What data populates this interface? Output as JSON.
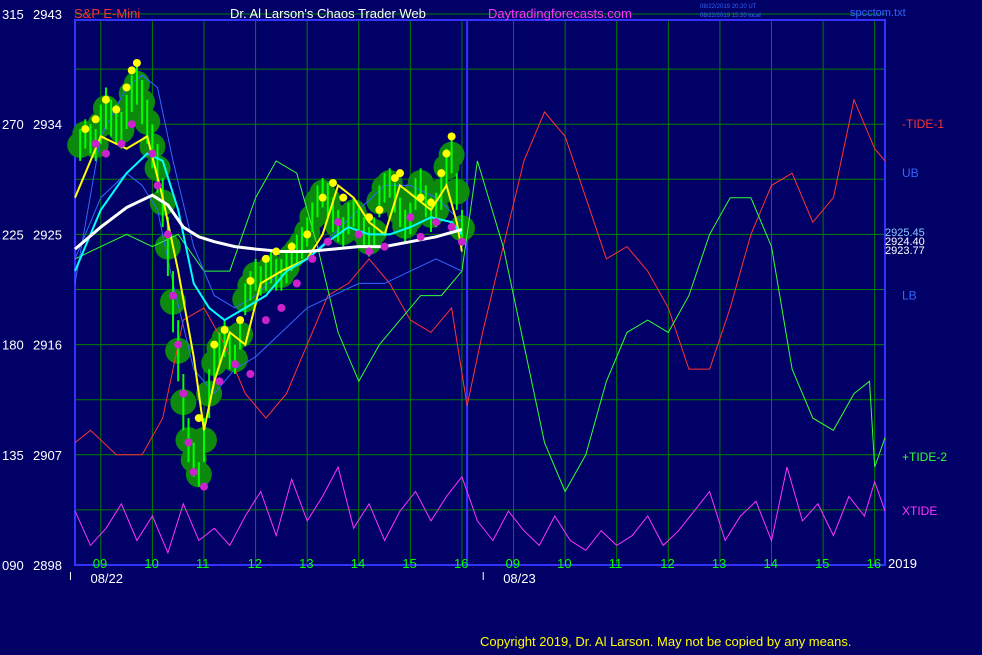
{
  "header": {
    "instrument": "S&P E-Mini",
    "site_title": "Dr. Al Larson's Chaos Trader Web",
    "site_url": "Daytradingforecasts.com",
    "stamp_line1": "08/22/2019 20:20 UT",
    "stamp_line2": "08/22/2019 15:20 local",
    "file_name": "spcctom.txt"
  },
  "footer": {
    "copyright": "Copyright 2019, Dr. Al Larson. May not be copied by any means."
  },
  "colors": {
    "background": "#000066",
    "grid": "#008000",
    "frame": "#3333ff",
    "price_bars": "#00ff00",
    "fast_avg": "#ffff00",
    "mid_avg": "#00ffff",
    "slow_avg": "#ffffff",
    "band": "#3366ff",
    "tide1": "#ff3333",
    "tide2": "#33ff33",
    "xtide": "#ff33ff",
    "highlight_glow": "#0d8a0d",
    "highs_dots": "#ffff00",
    "lows_dots": "#cc22cc"
  },
  "chart_data": {
    "type": "line",
    "y_axis_left_labels": [
      "315",
      "270",
      "225",
      "180",
      "135",
      "090"
    ],
    "y_axis_price_labels": [
      "2943",
      "2934",
      "2925",
      "2916",
      "2907",
      "2898"
    ],
    "y_ticks": [
      315,
      270,
      225,
      180,
      135,
      90
    ],
    "ylim": [
      90,
      315
    ],
    "x_ticks": [
      "09",
      "10",
      "11",
      "12",
      "13",
      "14",
      "15",
      "16",
      "09",
      "10",
      "11",
      "12",
      "13",
      "14",
      "15",
      "16"
    ],
    "x_tick_positions": [
      9,
      10,
      11,
      12,
      13,
      14,
      15,
      16,
      17,
      18,
      19,
      20,
      21,
      22,
      23,
      24
    ],
    "xlim": [
      8.5,
      24.2
    ],
    "date_labels": [
      {
        "text": "08/22",
        "x": 8.8
      },
      {
        "text": "08/23",
        "x": 16.8
      }
    ],
    "day_separator_x": 16.1,
    "year_label": "2019",
    "current_price_labels": [
      {
        "text": "2925.45",
        "color": "#88ccff"
      },
      {
        "text": "2924.40",
        "color": "#ffffff"
      },
      {
        "text": "2923.77",
        "color": "#ffffff"
      }
    ],
    "series": [
      {
        "name": "-TIDE-1",
        "legend_y": 270,
        "x": [
          8.5,
          8.8,
          9.3,
          9.8,
          10.2,
          10.6,
          11.0,
          11.4,
          11.8,
          12.2,
          12.6,
          13.0,
          13.4,
          13.8,
          14.2,
          14.6,
          15.0,
          15.4,
          15.8,
          16.1,
          16.4,
          16.8,
          17.2,
          17.6,
          18.0,
          18.4,
          18.8,
          19.2,
          19.6,
          20.0,
          20.4,
          20.8,
          21.2,
          21.6,
          22.0,
          22.4,
          22.8,
          23.2,
          23.6,
          23.9,
          24.0,
          24.2
        ],
        "values": [
          140,
          145,
          135,
          135,
          150,
          190,
          195,
          180,
          160,
          150,
          160,
          180,
          200,
          205,
          215,
          205,
          190,
          185,
          195,
          155,
          185,
          220,
          255,
          275,
          265,
          240,
          215,
          220,
          210,
          195,
          170,
          170,
          195,
          225,
          245,
          250,
          230,
          240,
          280,
          265,
          260,
          255
        ]
      },
      {
        "name": "+TIDE-2",
        "legend_y": 134,
        "x": [
          8.5,
          9.0,
          9.5,
          10.0,
          10.5,
          11.0,
          11.5,
          12.0,
          12.4,
          12.8,
          13.2,
          13.6,
          14.0,
          14.4,
          14.8,
          15.2,
          15.6,
          16.0,
          16.3,
          16.8,
          17.2,
          17.6,
          18.0,
          18.4,
          18.8,
          19.2,
          19.6,
          20.0,
          20.4,
          20.8,
          21.2,
          21.6,
          22.0,
          22.4,
          22.8,
          23.2,
          23.6,
          23.9,
          24.0,
          24.2
        ],
        "values": [
          215,
          220,
          225,
          220,
          225,
          210,
          210,
          240,
          255,
          250,
          220,
          185,
          165,
          180,
          190,
          200,
          200,
          210,
          255,
          220,
          180,
          140,
          120,
          135,
          165,
          185,
          190,
          185,
          200,
          225,
          240,
          240,
          220,
          170,
          150,
          145,
          160,
          165,
          130,
          142
        ]
      },
      {
        "name": "XTIDE",
        "legend_y": 112,
        "x": [
          8.5,
          8.8,
          9.1,
          9.4,
          9.7,
          10.0,
          10.3,
          10.6,
          10.9,
          11.2,
          11.5,
          11.8,
          12.1,
          12.4,
          12.7,
          13.0,
          13.3,
          13.6,
          13.9,
          14.2,
          14.5,
          14.8,
          15.1,
          15.4,
          15.7,
          16.0,
          16.3,
          16.6,
          16.9,
          17.2,
          17.5,
          17.8,
          18.1,
          18.4,
          18.7,
          19.0,
          19.3,
          19.6,
          19.9,
          20.2,
          20.5,
          20.8,
          21.1,
          21.4,
          21.7,
          22.0,
          22.3,
          22.6,
          22.9,
          23.2,
          23.5,
          23.8,
          24.0,
          24.2
        ],
        "values": [
          112,
          98,
          105,
          115,
          100,
          110,
          95,
          115,
          100,
          105,
          98,
          110,
          120,
          102,
          125,
          108,
          118,
          130,
          105,
          115,
          100,
          112,
          120,
          108,
          118,
          126,
          108,
          100,
          112,
          104,
          98,
          110,
          100,
          96,
          104,
          98,
          102,
          110,
          98,
          104,
          112,
          120,
          100,
          110,
          116,
          100,
          130,
          108,
          115,
          102,
          118,
          110,
          124,
          112
        ]
      },
      {
        "name": "UB",
        "legend_y": 250,
        "x": [
          8.5,
          9.0,
          9.5,
          9.8,
          10.1,
          10.4,
          10.8,
          11.2,
          11.6,
          12.0,
          12.5,
          13.0,
          13.5,
          14.0,
          14.5,
          15.0,
          15.5,
          16.0
        ],
        "values": [
          205,
          265,
          285,
          290,
          285,
          255,
          220,
          200,
          195,
          200,
          210,
          215,
          225,
          235,
          245,
          245,
          240,
          230
        ]
      },
      {
        "name": "LB",
        "legend_y": 200,
        "x": [
          8.5,
          9.0,
          9.5,
          9.8,
          10.1,
          10.4,
          10.8,
          11.2,
          11.6,
          12.0,
          12.5,
          13.0,
          13.5,
          14.0,
          14.5,
          15.0,
          15.5,
          16.0
        ],
        "values": [
          215,
          240,
          250,
          245,
          235,
          205,
          170,
          160,
          170,
          175,
          185,
          195,
          200,
          205,
          205,
          210,
          215,
          210
        ]
      },
      {
        "name": "",
        "x": [
          8.5,
          9.0,
          9.5,
          9.9,
          10.2,
          10.5,
          10.8,
          11.0,
          11.2,
          11.5,
          11.8,
          12.1,
          12.5,
          13.0,
          13.3,
          13.6,
          13.9,
          14.2,
          14.5,
          14.8,
          15.1,
          15.4,
          15.7,
          15.9,
          16.0
        ],
        "values": [
          240,
          265,
          260,
          265,
          240,
          210,
          175,
          145,
          165,
          185,
          180,
          205,
          210,
          215,
          225,
          245,
          240,
          230,
          225,
          245,
          240,
          235,
          245,
          230,
          218
        ]
      },
      {
        "name": "",
        "x": [
          8.5,
          9.0,
          9.5,
          9.9,
          10.2,
          10.5,
          10.8,
          11.1,
          11.4,
          11.8,
          12.2,
          12.6,
          13.0,
          13.4,
          13.8,
          14.2,
          14.6,
          15.0,
          15.4,
          15.8,
          16.0
        ],
        "values": [
          210,
          235,
          250,
          258,
          255,
          235,
          205,
          195,
          190,
          195,
          200,
          210,
          215,
          222,
          228,
          225,
          225,
          228,
          232,
          230,
          225
        ]
      },
      {
        "name": "",
        "x": [
          8.5,
          9.0,
          9.5,
          10.0,
          10.3,
          10.6,
          10.9,
          11.2,
          11.6,
          12.0,
          12.5,
          13.0,
          13.5,
          14.0,
          14.5,
          15.0,
          15.5,
          16.0
        ],
        "values": [
          219,
          228,
          236,
          241,
          237,
          228,
          224,
          222,
          220,
          219,
          218,
          218,
          219,
          220,
          220,
          222,
          224,
          227
        ]
      }
    ],
    "price_bars": {
      "x": [
        8.6,
        8.7,
        8.8,
        8.9,
        9.0,
        9.1,
        9.2,
        9.3,
        9.4,
        9.5,
        9.6,
        9.7,
        9.8,
        9.9,
        10.0,
        10.1,
        10.2,
        10.3,
        10.4,
        10.5,
        10.6,
        10.7,
        10.8,
        10.9,
        11.0,
        11.1,
        11.2,
        11.3,
        11.4,
        11.5,
        11.6,
        11.7,
        11.8,
        11.9,
        12.0,
        12.1,
        12.2,
        12.3,
        12.4,
        12.5,
        12.6,
        12.7,
        12.8,
        12.9,
        13.0,
        13.1,
        13.2,
        13.3,
        13.4,
        13.5,
        13.6,
        13.7,
        13.8,
        13.9,
        14.0,
        14.1,
        14.2,
        14.3,
        14.4,
        14.5,
        14.6,
        14.7,
        14.8,
        14.9,
        15.0,
        15.1,
        15.2,
        15.3,
        15.4,
        15.5,
        15.6,
        15.7,
        15.8,
        15.9,
        16.0
      ],
      "high": [
        268,
        272,
        270,
        268,
        278,
        285,
        280,
        278,
        275,
        282,
        290,
        295,
        288,
        280,
        270,
        262,
        248,
        232,
        210,
        190,
        168,
        150,
        140,
        132,
        150,
        170,
        180,
        185,
        190,
        185,
        180,
        190,
        205,
        210,
        215,
        212,
        215,
        218,
        215,
        215,
        218,
        222,
        225,
        228,
        232,
        238,
        245,
        248,
        246,
        240,
        235,
        232,
        238,
        240,
        236,
        232,
        228,
        232,
        245,
        250,
        252,
        246,
        240,
        235,
        238,
        248,
        252,
        245,
        240,
        242,
        250,
        260,
        265,
        250,
        235
      ],
      "low": [
        255,
        260,
        258,
        255,
        262,
        268,
        265,
        262,
        260,
        268,
        275,
        278,
        270,
        262,
        252,
        242,
        228,
        208,
        185,
        165,
        145,
        132,
        126,
        122,
        132,
        150,
        165,
        172,
        175,
        170,
        168,
        178,
        192,
        198,
        202,
        200,
        202,
        205,
        202,
        202,
        205,
        210,
        212,
        215,
        220,
        226,
        232,
        236,
        232,
        226,
        222,
        220,
        225,
        228,
        224,
        220,
        216,
        220,
        232,
        238,
        240,
        234,
        228,
        222,
        225,
        235,
        240,
        232,
        226,
        228,
        235,
        245,
        250,
        235,
        220
      ]
    },
    "highs_markers": {
      "x": [
        8.7,
        8.9,
        9.1,
        9.3,
        9.5,
        9.6,
        9.7,
        10.9,
        11.2,
        11.4,
        11.7,
        11.9,
        12.2,
        12.4,
        12.7,
        13.0,
        13.3,
        13.5,
        13.7,
        14.2,
        14.4,
        14.7,
        14.8,
        15.2,
        15.4,
        15.6,
        15.7,
        15.8
      ],
      "values": [
        268,
        272,
        280,
        276,
        285,
        292,
        295,
        150,
        180,
        186,
        190,
        206,
        215,
        218,
        220,
        225,
        240,
        246,
        240,
        232,
        235,
        248,
        250,
        240,
        238,
        250,
        258,
        265
      ]
    },
    "lows_markers": {
      "x": [
        8.9,
        9.1,
        9.4,
        9.6,
        10.0,
        10.1,
        10.3,
        10.4,
        10.5,
        10.6,
        10.7,
        10.8,
        11.0,
        11.3,
        11.6,
        11.9,
        12.2,
        12.5,
        12.8,
        13.1,
        13.4,
        13.6,
        14.0,
        14.2,
        14.5,
        15.0,
        15.2,
        15.5,
        15.8,
        16.0
      ],
      "values": [
        262,
        258,
        262,
        270,
        258,
        245,
        225,
        200,
        180,
        160,
        140,
        128,
        122,
        165,
        172,
        168,
        190,
        195,
        205,
        215,
        222,
        230,
        225,
        218,
        220,
        232,
        224,
        230,
        228,
        222
      ]
    }
  }
}
